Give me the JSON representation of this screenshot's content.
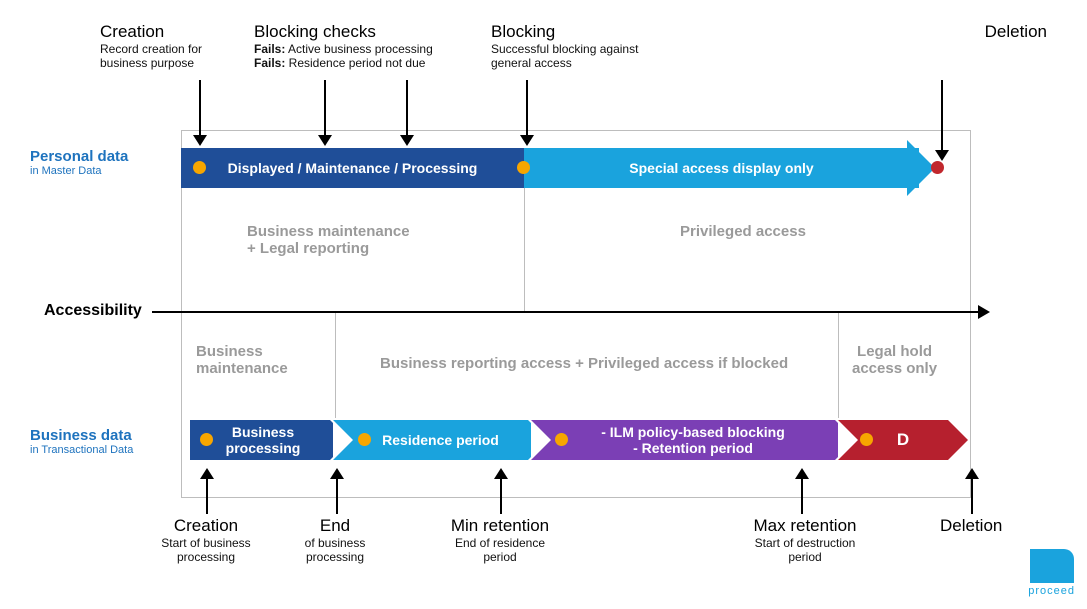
{
  "top": {
    "creation": {
      "title": "Creation",
      "line1": "Record creation for",
      "line2": "business purpose"
    },
    "blocking_checks": {
      "title": "Blocking checks",
      "line1": "Fails: Active business processing",
      "line2": "Fails: Residence period not due",
      "fails_label": "Fails:"
    },
    "blocking": {
      "title": "Blocking",
      "line1": "Successful blocking against",
      "line2": "general access"
    },
    "deletion": {
      "title": "Deletion"
    }
  },
  "left": {
    "personal": {
      "title": "Personal data",
      "sub": "in Master Data"
    },
    "accessibility": "Accessibility",
    "business": {
      "title": "Business data",
      "sub": "in Transactional Data"
    }
  },
  "personal_bar": {
    "seg1": "Displayed / Maintenance / Processing",
    "seg2": "Special access display only"
  },
  "middle": {
    "left1": "Business maintenance",
    "left2": "+ Legal reporting",
    "right": "Privileged access",
    "lower_left1": "Business",
    "lower_left2": "maintenance",
    "lower_mid": "Business reporting access + Privileged access if blocked",
    "lower_right1": "Legal hold",
    "lower_right2": "access only"
  },
  "business_bar": {
    "seg1_l1": "Business",
    "seg1_l2": "processing",
    "seg2": "Residence period",
    "seg3_l1": "- ILM policy-based blocking",
    "seg3_l2": "- Retention period",
    "seg4": "D"
  },
  "bottom": {
    "creation": {
      "title": "Creation",
      "l1": "Start of business",
      "l2": "processing"
    },
    "end": {
      "title": "End",
      "l1": "of business",
      "l2": "processing"
    },
    "min": {
      "title": "Min retention",
      "l1": "End of residence",
      "l2": "period"
    },
    "max": {
      "title": "Max retention",
      "l1": "Start of destruction",
      "l2": "period"
    },
    "deletion": {
      "title": "Deletion"
    }
  },
  "colors": {
    "darkblue": "#1f4e98",
    "lightblue": "#1aa3dd",
    "purple": "#7b3fb5",
    "red": "#b6202e"
  },
  "logo": "proceed"
}
